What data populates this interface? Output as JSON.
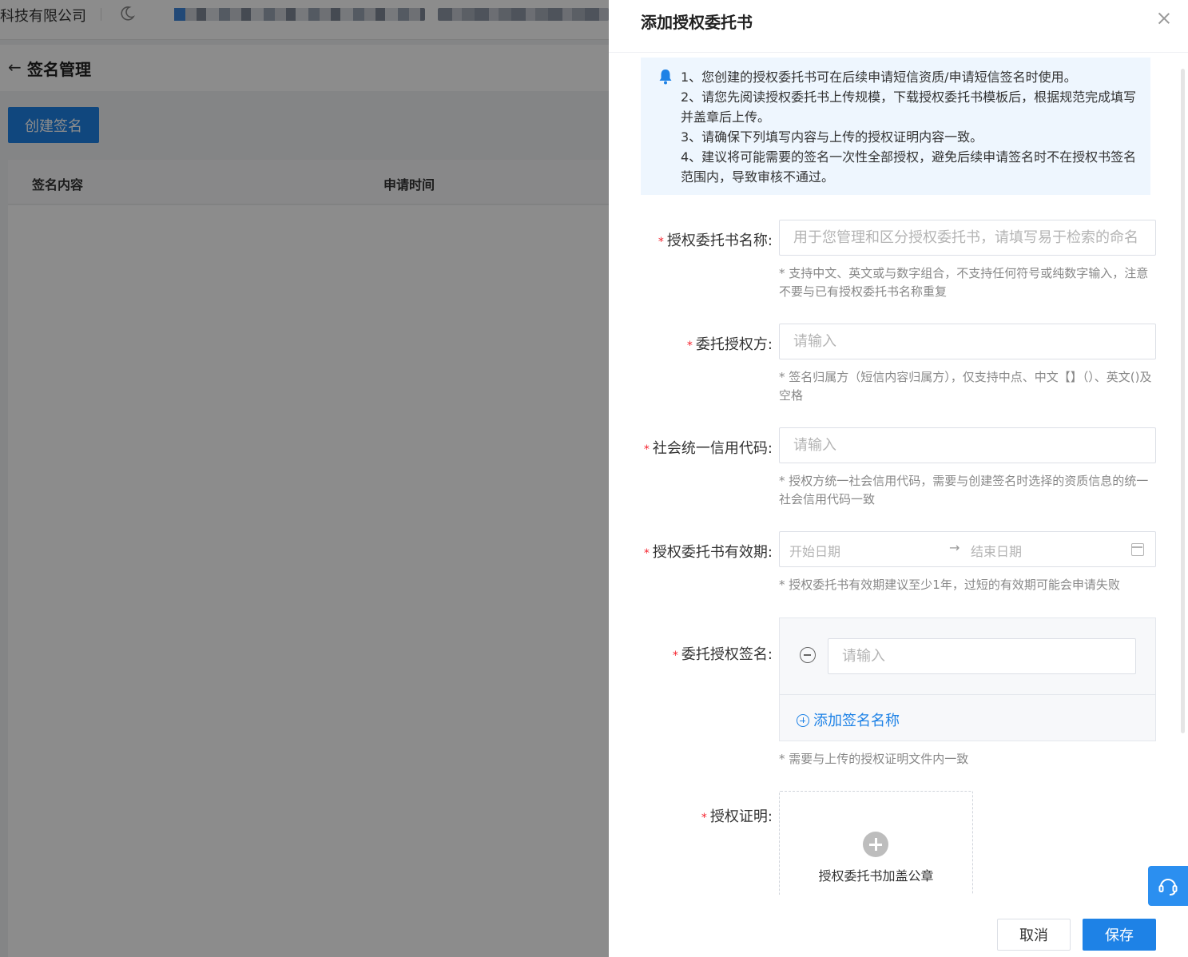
{
  "background": {
    "company_name": "科技有限公司",
    "page_title": "签名管理",
    "create_button": "创建签名",
    "table_columns": [
      "签名内容",
      "申请时间"
    ]
  },
  "drawer": {
    "title": "添加授权委托书",
    "notice_lines": [
      "1、您创建的授权委托书可在后续申请短信资质/申请短信签名时使用。",
      "2、请您先阅读授权委托书上传规模，下载授权委托书模板后，根据规范完成填写并盖章后上传。",
      "3、请确保下列填写内容与上传的授权证明内容一致。",
      "4、建议将可能需要的签名一次性全部授权，避免后续申请签名时不在授权书签名范围内，导致审核不通过。"
    ],
    "required_mark": "*",
    "fields": {
      "name": {
        "label": "授权委托书名称:",
        "placeholder": "用于您管理和区分授权委托书，请填写易于检索的命名",
        "value": "",
        "hint": "* 支持中文、英文或与数字组合，不支持任何符号或纯数字输入，注意不要与已有授权委托书名称重复"
      },
      "authorizer": {
        "label": "委托授权方:",
        "placeholder": "请输入",
        "value": "",
        "hint": "* 签名归属方（短信内容归属方），仅支持中点、中文【】（）、英文()及空格"
      },
      "credit_code": {
        "label": "社会统一信用代码:",
        "placeholder": "请输入",
        "value": "",
        "hint": "* 授权方统一社会信用代码，需要与创建签名时选择的资质信息的统一社会信用代码一致"
      },
      "validity": {
        "label": "授权委托书有效期:",
        "start_placeholder": "开始日期",
        "separator": "→",
        "end_placeholder": "结束日期",
        "hint": "* 授权委托书有效期建议至少1年，过短的有效期可能会申请失败"
      },
      "signatures": {
        "label": "委托授权签名:",
        "placeholder": "请输入",
        "value": "",
        "add_label": "添加签名名称",
        "hint": "* 需要与上传的授权证明文件内一致"
      },
      "proof": {
        "label": "授权证明:",
        "upload_label": "授权委托书加盖公章"
      }
    },
    "footer": {
      "cancel_label": "取消",
      "save_label": "保存"
    }
  },
  "colors": {
    "primary": "#1e82e6",
    "required": "#f5222d",
    "notice_bg": "#eef6fe"
  },
  "icons": [
    "moon-icon",
    "back-arrow-icon",
    "close-icon",
    "bell-icon",
    "remove-circle-icon",
    "add-circle-icon",
    "upload-plus-icon",
    "calendar-icon",
    "customer-service-icon"
  ]
}
